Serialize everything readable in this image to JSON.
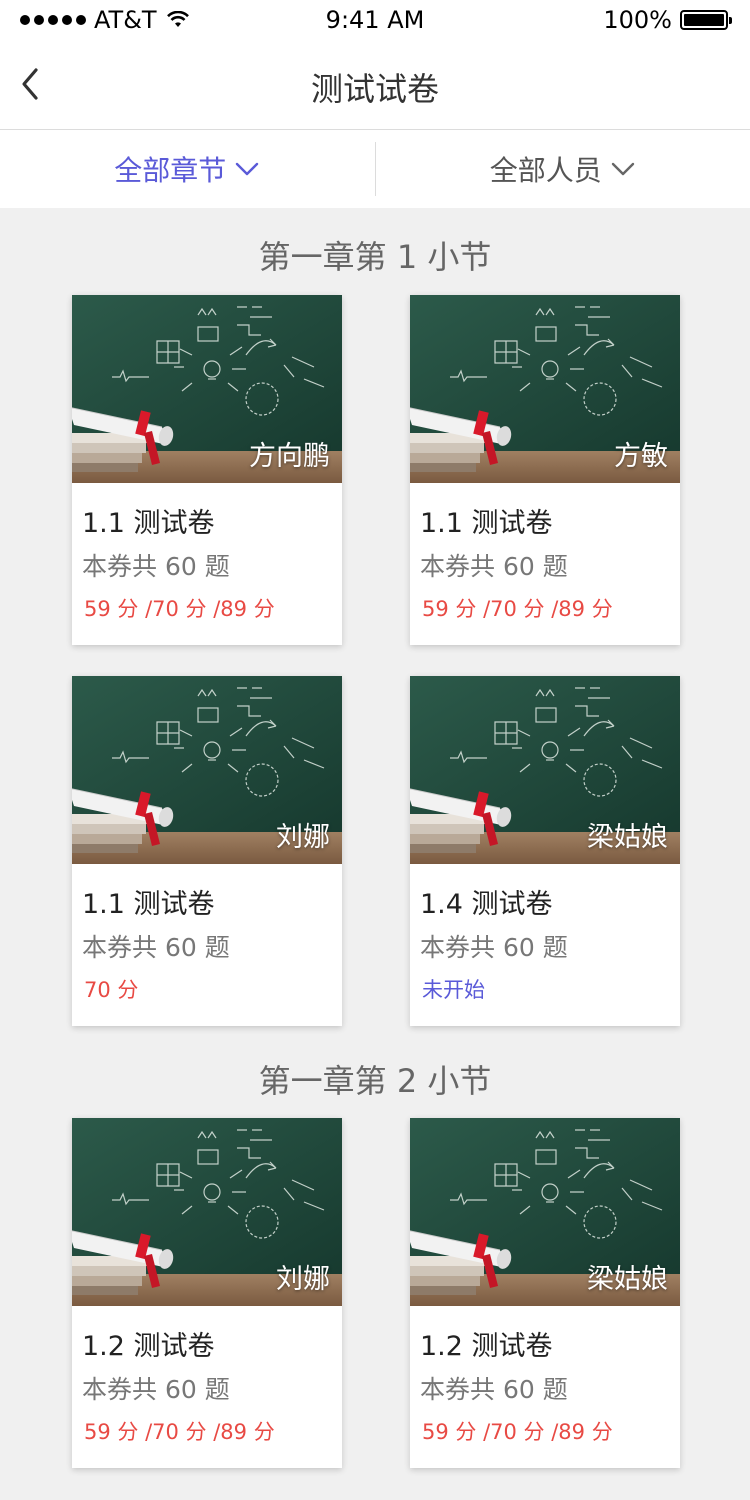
{
  "status": {
    "carrier": "AT&T",
    "time": "9:41 AM",
    "battery": "100%"
  },
  "nav": {
    "title": "测试试卷"
  },
  "filters": {
    "chapter": "全部章节",
    "people": "全部人员"
  },
  "sections": [
    {
      "title": "第一章第 1 小节",
      "cards": [
        {
          "name": "方向鹏",
          "title": "1.1 测试卷",
          "count": "本券共 60 题",
          "score": "59 分 /70 分 /89 分",
          "score_color": "#e84a44"
        },
        {
          "name": "方敏",
          "title": "1.1 测试卷",
          "count": "本券共 60 题",
          "score": "59 分 /70 分 /89 分",
          "score_color": "#e84a44"
        },
        {
          "name": "刘娜",
          "title": "1.1 测试卷",
          "count": "本券共 60 题",
          "score": "70 分",
          "score_color": "#e84a44"
        },
        {
          "name": "梁姑娘",
          "title": "1.4 测试卷",
          "count": "本券共 60 题",
          "score": "未开始",
          "score_color": "#5a5ad8"
        }
      ]
    },
    {
      "title": "第一章第 2 小节",
      "cards": [
        {
          "name": "刘娜",
          "title": "1.2 测试卷",
          "count": "本券共 60 题",
          "score": "59 分 /70 分 /89 分",
          "score_color": "#e84a44"
        },
        {
          "name": "梁姑娘",
          "title": "1.2 测试卷",
          "count": "本券共 60 题",
          "score": "59 分 /70 分 /89 分",
          "score_color": "#e84a44"
        }
      ]
    }
  ],
  "icons": {
    "back": "chevron-left-icon",
    "dropdown": "chevron-down-icon",
    "thumbnail": "chalkboard-diploma-image"
  },
  "colors": {
    "accent": "#5a5ad8",
    "score": "#e84a44",
    "background": "#f0f0f0"
  }
}
